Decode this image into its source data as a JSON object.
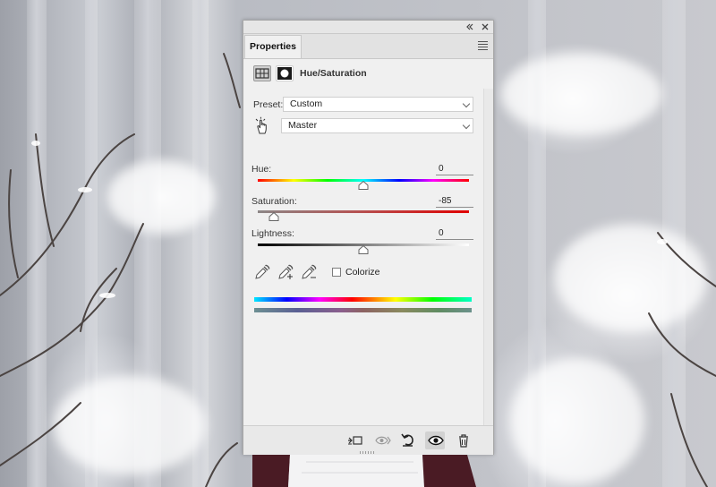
{
  "panel": {
    "tab_label": "Properties",
    "adjustment_title": "Hue/Saturation",
    "preset_label": "Preset:",
    "preset_value": "Custom",
    "channel_value": "Master",
    "hue": {
      "label": "Hue:",
      "value": "0",
      "level": 0.5
    },
    "saturation": {
      "label": "Saturation:",
      "value": "-85",
      "level": 0.075
    },
    "lightness": {
      "label": "Lightness:",
      "value": "0",
      "level": 0.5
    },
    "colorize_label": "Colorize",
    "colorize_checked": false
  },
  "icons": {
    "collapse": "double-chevron-left-icon",
    "close": "close-icon",
    "panel_menu": "hamburger-menu-icon",
    "adjustment": "adjustment-layer-icon",
    "mask": "layer-mask-icon",
    "targeted_adjustment": "hand-scrubby-icon",
    "eyedropper": "eyedropper-icon",
    "eyedropper_add": "eyedropper-plus-icon",
    "eyedropper_subtract": "eyedropper-minus-icon",
    "clip": "clip-to-layer-icon",
    "view_previous": "view-previous-state-icon",
    "reset": "reset-icon",
    "visibility": "eye-icon",
    "delete": "trash-icon"
  },
  "colors": {
    "panel_bg": "#f0f0f0",
    "saturation_track_end": "#e00000"
  }
}
